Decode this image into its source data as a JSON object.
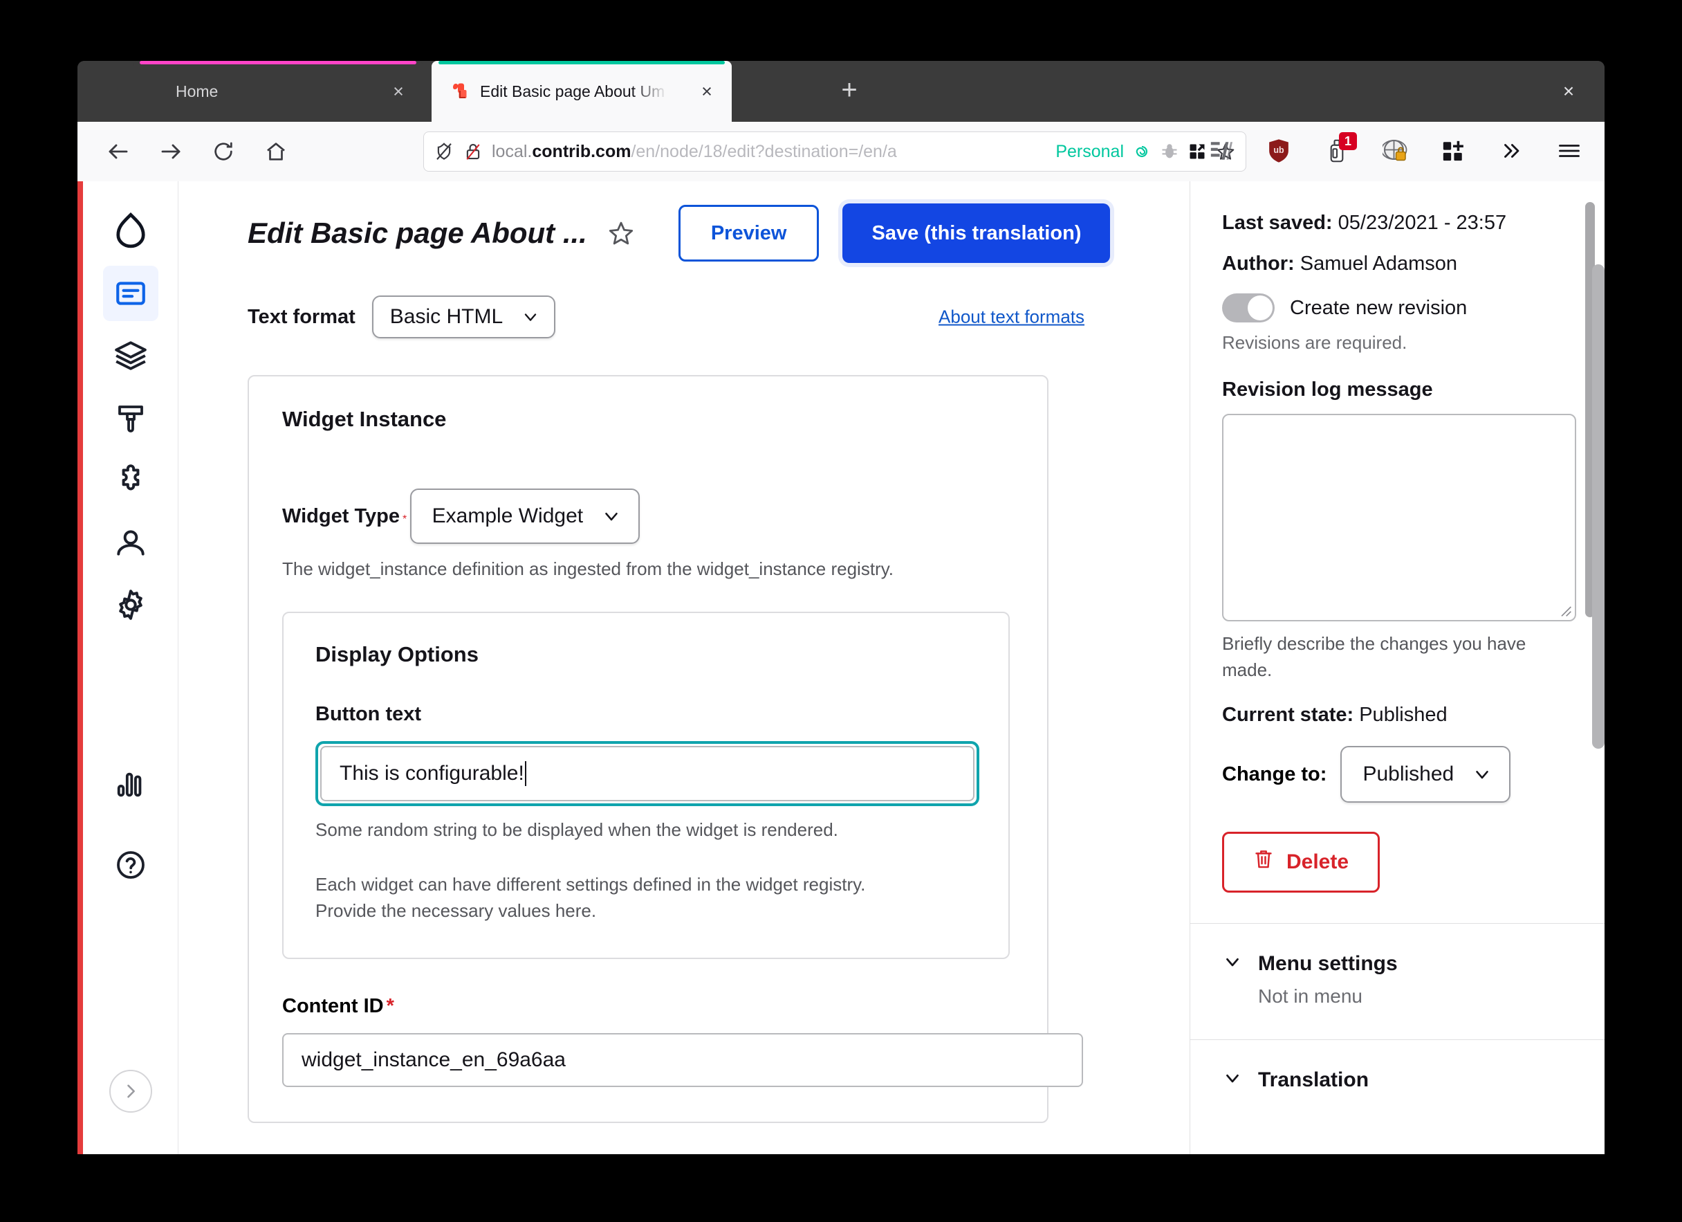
{
  "browser": {
    "tabs": [
      {
        "title": "Home",
        "accent_color": "#ff44c8",
        "active": false,
        "close_label": "×"
      },
      {
        "title": "Edit Basic page About Um",
        "accent_color": "#00c79e",
        "active": true,
        "close_label": "×"
      }
    ],
    "new_tab_label": "+",
    "window_close_label": "×",
    "nav": {
      "back_label": "back-arrow",
      "forward_label": "forward-arrow",
      "reload_label": "reload",
      "home_label": "home"
    },
    "url": {
      "prefix": "local.",
      "domain": "contrib.com",
      "path": "/en/node/18/edit?destination=/en/a",
      "container": "Personal"
    },
    "extensions": [
      {
        "name": "stylus-icon",
        "badge": ""
      },
      {
        "name": "ublock-origin-icon",
        "badge": ""
      },
      {
        "name": "clear-cache-icon",
        "badge": "1"
      },
      {
        "name": "privacy-globe-icon",
        "badge": ""
      },
      {
        "name": "add-grid-icon",
        "badge": ""
      },
      {
        "name": "overflow-chevrons-icon",
        "badge": ""
      },
      {
        "name": "app-menu-icon",
        "badge": ""
      }
    ]
  },
  "toolbar_rail": {
    "logo": "drupal-droplet-logo",
    "items": [
      {
        "name": "content",
        "icon": "content-icon",
        "active": true
      },
      {
        "name": "structure",
        "icon": "layers-icon",
        "active": false
      },
      {
        "name": "appearance",
        "icon": "paintbrush-icon",
        "active": false
      },
      {
        "name": "extend",
        "icon": "puzzle-icon",
        "active": false
      },
      {
        "name": "people",
        "icon": "person-icon",
        "active": false
      },
      {
        "name": "configuration",
        "icon": "gear-icon",
        "active": false
      }
    ],
    "bottom_items": [
      {
        "name": "reports",
        "icon": "bar-chart-icon"
      },
      {
        "name": "help",
        "icon": "question-circle-icon"
      }
    ],
    "expand_label": "expand-chevron-icon"
  },
  "header": {
    "title": "Edit Basic page About ...",
    "star_label": "star-icon",
    "preview_label": "Preview",
    "save_label": "Save (this translation)"
  },
  "form": {
    "text_format": {
      "label": "Text format",
      "value": "Basic HTML",
      "about_link": "About text formats"
    },
    "widget_instance": {
      "heading": "Widget Instance",
      "widget_type_label": "Widget Type",
      "widget_type_required": "*",
      "widget_type_value": "Example Widget",
      "widget_type_help": "The widget_instance definition as ingested from the widget_instance registry."
    },
    "display_options": {
      "heading": "Display Options",
      "button_text_label": "Button text",
      "button_text_value": "This is configurable!",
      "button_text_help": "Some random string to be displayed when the widget is rendered.",
      "section_help": "Each widget can have different settings defined in the widget registry. Provide the necessary values here."
    },
    "content_id": {
      "label": "Content ID",
      "required": "*",
      "value": "widget_instance_en_69a6aa"
    }
  },
  "sidebar": {
    "last_saved_label": "Last saved:",
    "last_saved_value": "05/23/2021 - 23:57",
    "author_label": "Author:",
    "author_value": "Samuel Adamson",
    "create_revision_label": "Create new revision",
    "revisions_note": "Revisions are required.",
    "revision_log_label": "Revision log message",
    "revision_log_value": "",
    "revision_log_help": "Briefly describe the changes you have made.",
    "current_state_label": "Current state:",
    "current_state_value": "Published",
    "change_to_label": "Change to:",
    "change_to_value": "Published",
    "delete_label": "Delete",
    "menu_settings_title": "Menu settings",
    "menu_settings_sub": "Not in menu",
    "translation_title": "Translation"
  },
  "colors": {
    "accent_blue": "#1346e3",
    "focus_teal": "#10a4ad",
    "danger_red": "#d8232a",
    "tab_active_accent": "#00c79e",
    "tab_inactive_accent": "#ff44c8"
  }
}
